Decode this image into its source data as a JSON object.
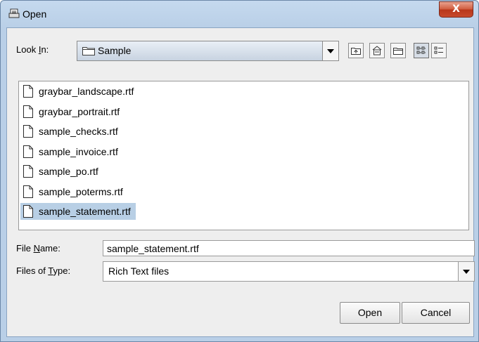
{
  "window": {
    "title": "Open",
    "close_glyph": "X"
  },
  "lookin": {
    "label_pre": "Look ",
    "label_mnemonic": "I",
    "label_post": "n:",
    "value": "Sample"
  },
  "toolbar": {
    "icons": [
      "up-one-level-icon",
      "home-icon",
      "new-folder-icon",
      "list-view-icon",
      "details-view-icon"
    ]
  },
  "files": [
    {
      "name": "graybar_landscape.rtf",
      "selected": false
    },
    {
      "name": "graybar_portrait.rtf",
      "selected": false
    },
    {
      "name": "sample_checks.rtf",
      "selected": false
    },
    {
      "name": "sample_invoice.rtf",
      "selected": false
    },
    {
      "name": "sample_po.rtf",
      "selected": false
    },
    {
      "name": "sample_poterms.rtf",
      "selected": false
    },
    {
      "name": "sample_statement.rtf",
      "selected": true
    }
  ],
  "filename": {
    "label_pre": "File ",
    "label_mnemonic": "N",
    "label_post": "ame:",
    "value": "sample_statement.rtf"
  },
  "filetype": {
    "label_pre": "Files of ",
    "label_mnemonic": "T",
    "label_post": "ype:",
    "value": "Rich Text files"
  },
  "buttons": {
    "open": "Open",
    "cancel": "Cancel"
  },
  "colors": {
    "selection": "#b8cfe5",
    "titlebar": "#c5d9ee",
    "close": "#c74a2c"
  }
}
